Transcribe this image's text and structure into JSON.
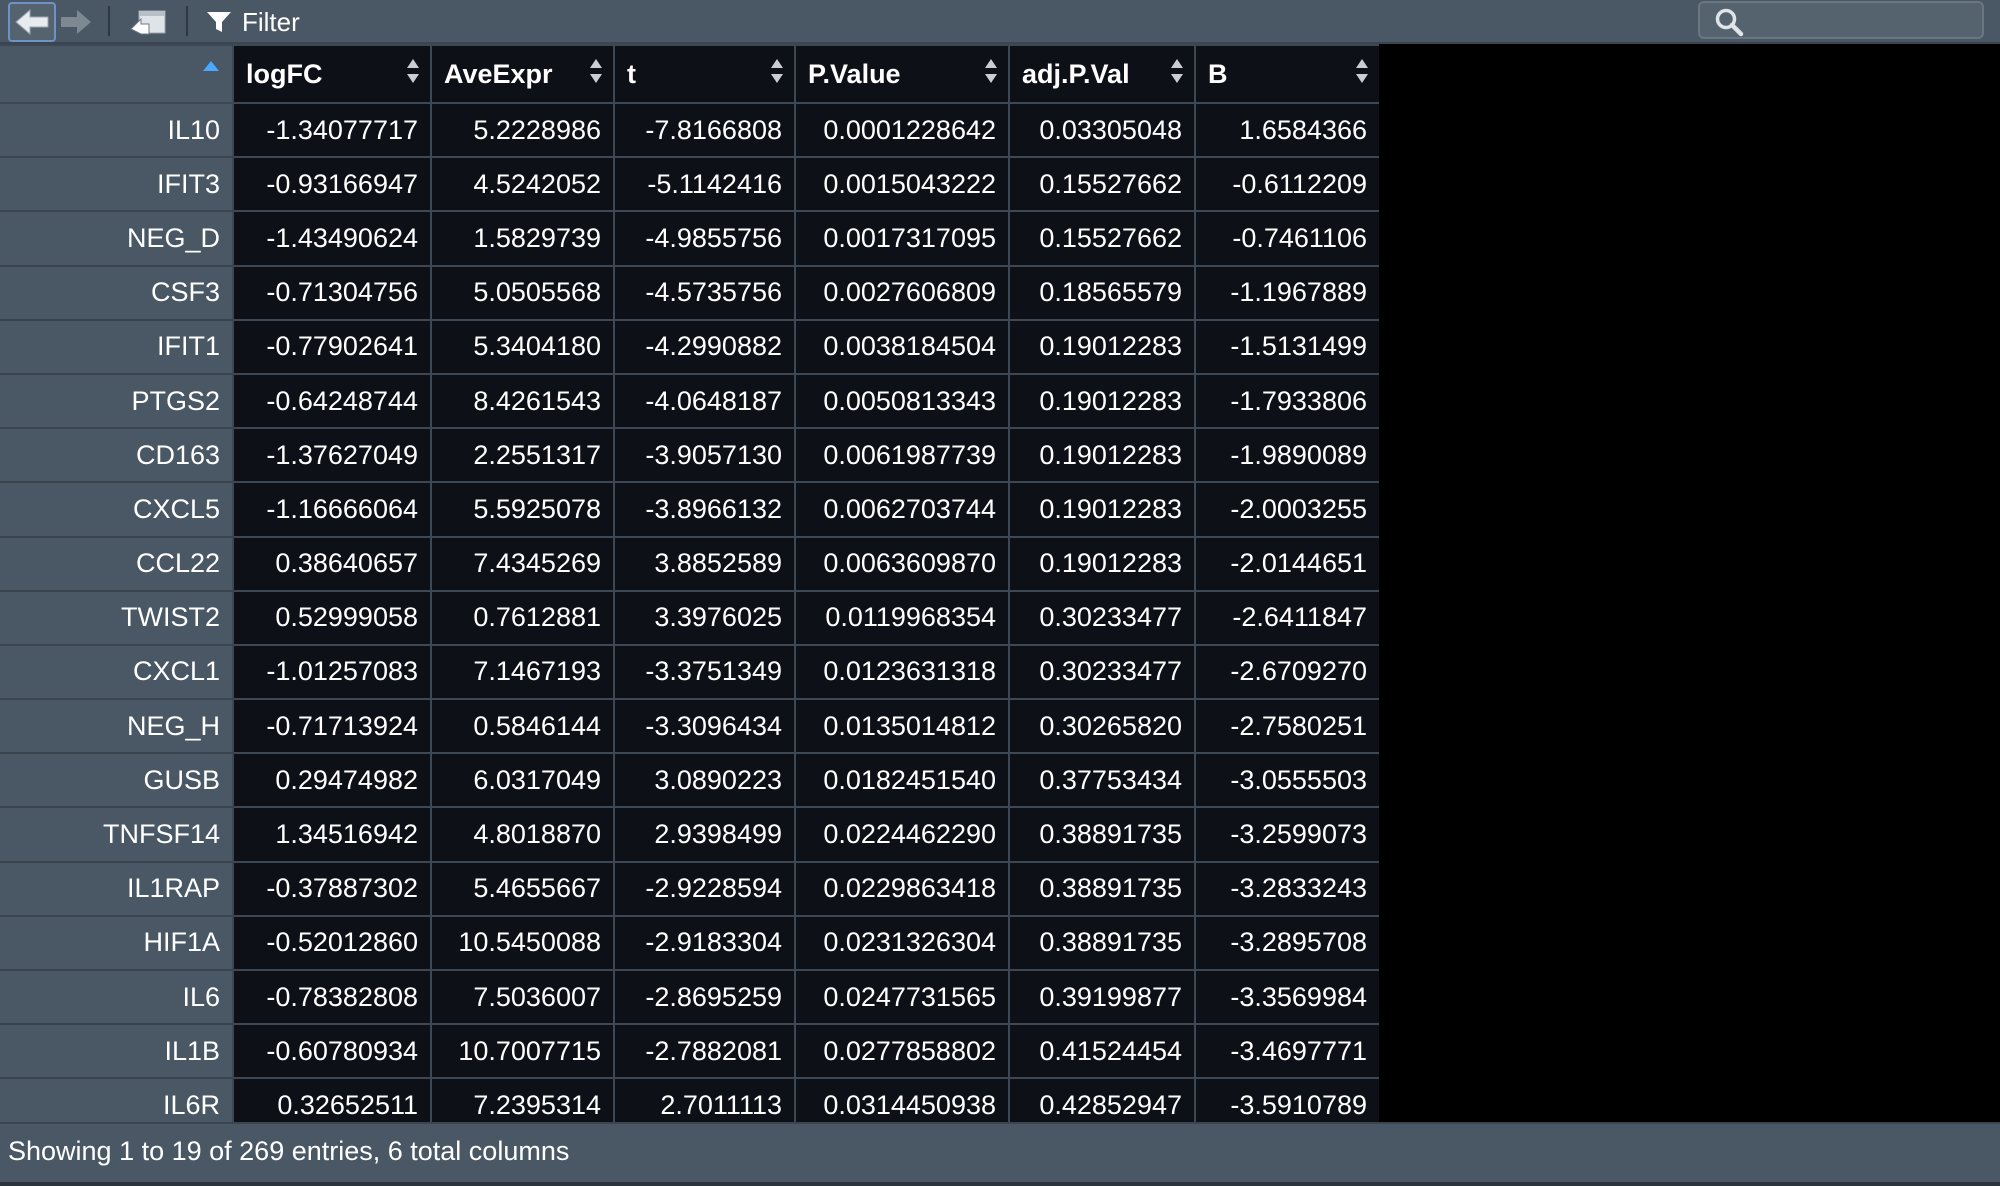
{
  "toolbar": {
    "filter_label": "Filter",
    "search": {
      "value": "",
      "placeholder": ""
    }
  },
  "table": {
    "sorted_column": "rownames",
    "sort_direction": "ascending",
    "columns": [
      "",
      "logFC",
      "AveExpr",
      "t",
      "P.Value",
      "adj.P.Val",
      "B"
    ],
    "rows": [
      [
        "IL10",
        "-1.34077717",
        "5.2228986",
        "-7.8166808",
        "0.0001228642",
        "0.03305048",
        "1.6584366"
      ],
      [
        "IFIT3",
        "-0.93166947",
        "4.5242052",
        "-5.1142416",
        "0.0015043222",
        "0.15527662",
        "-0.6112209"
      ],
      [
        "NEG_D",
        "-1.43490624",
        "1.5829739",
        "-4.9855756",
        "0.0017317095",
        "0.15527662",
        "-0.7461106"
      ],
      [
        "CSF3",
        "-0.71304756",
        "5.0505568",
        "-4.5735756",
        "0.0027606809",
        "0.18565579",
        "-1.1967889"
      ],
      [
        "IFIT1",
        "-0.77902641",
        "5.3404180",
        "-4.2990882",
        "0.0038184504",
        "0.19012283",
        "-1.5131499"
      ],
      [
        "PTGS2",
        "-0.64248744",
        "8.4261543",
        "-4.0648187",
        "0.0050813343",
        "0.19012283",
        "-1.7933806"
      ],
      [
        "CD163",
        "-1.37627049",
        "2.2551317",
        "-3.9057130",
        "0.0061987739",
        "0.19012283",
        "-1.9890089"
      ],
      [
        "CXCL5",
        "-1.16666064",
        "5.5925078",
        "-3.8966132",
        "0.0062703744",
        "0.19012283",
        "-2.0003255"
      ],
      [
        "CCL22",
        "0.38640657",
        "7.4345269",
        "3.8852589",
        "0.0063609870",
        "0.19012283",
        "-2.0144651"
      ],
      [
        "TWIST2",
        "0.52999058",
        "0.7612881",
        "3.3976025",
        "0.0119968354",
        "0.30233477",
        "-2.6411847"
      ],
      [
        "CXCL1",
        "-1.01257083",
        "7.1467193",
        "-3.3751349",
        "0.0123631318",
        "0.30233477",
        "-2.6709270"
      ],
      [
        "NEG_H",
        "-0.71713924",
        "0.5846144",
        "-3.3096434",
        "0.0135014812",
        "0.30265820",
        "-2.7580251"
      ],
      [
        "GUSB",
        "0.29474982",
        "6.0317049",
        "3.0890223",
        "0.0182451540",
        "0.37753434",
        "-3.0555503"
      ],
      [
        "TNFSF14",
        "1.34516942",
        "4.8018870",
        "2.9398499",
        "0.0224462290",
        "0.38891735",
        "-3.2599073"
      ],
      [
        "IL1RAP",
        "-0.37887302",
        "5.4655667",
        "-2.9228594",
        "0.0229863418",
        "0.38891735",
        "-3.2833243"
      ],
      [
        "HIF1A",
        "-0.52012860",
        "10.5450088",
        "-2.9183304",
        "0.0231326304",
        "0.38891735",
        "-3.2895708"
      ],
      [
        "IL6",
        "-0.78382808",
        "7.5036007",
        "-2.8695259",
        "0.0247731565",
        "0.39199877",
        "-3.3569984"
      ],
      [
        "IL1B",
        "-0.60780934",
        "10.7007715",
        "-2.7882081",
        "0.0277858802",
        "0.41524454",
        "-3.4697771"
      ],
      [
        "IL6R",
        "0.32652511",
        "7.2395314",
        "2.7011113",
        "0.0314450938",
        "0.42852947",
        "-3.5910789"
      ]
    ]
  },
  "status": {
    "text": "Showing 1 to 19 of 269 entries, 6 total columns"
  },
  "colors": {
    "toolbar_bg": "#4a5765",
    "cell_bg": "#0d1016",
    "grid_line": "#3d4854",
    "text": "#ffffff",
    "accent": "#6f93c8"
  }
}
